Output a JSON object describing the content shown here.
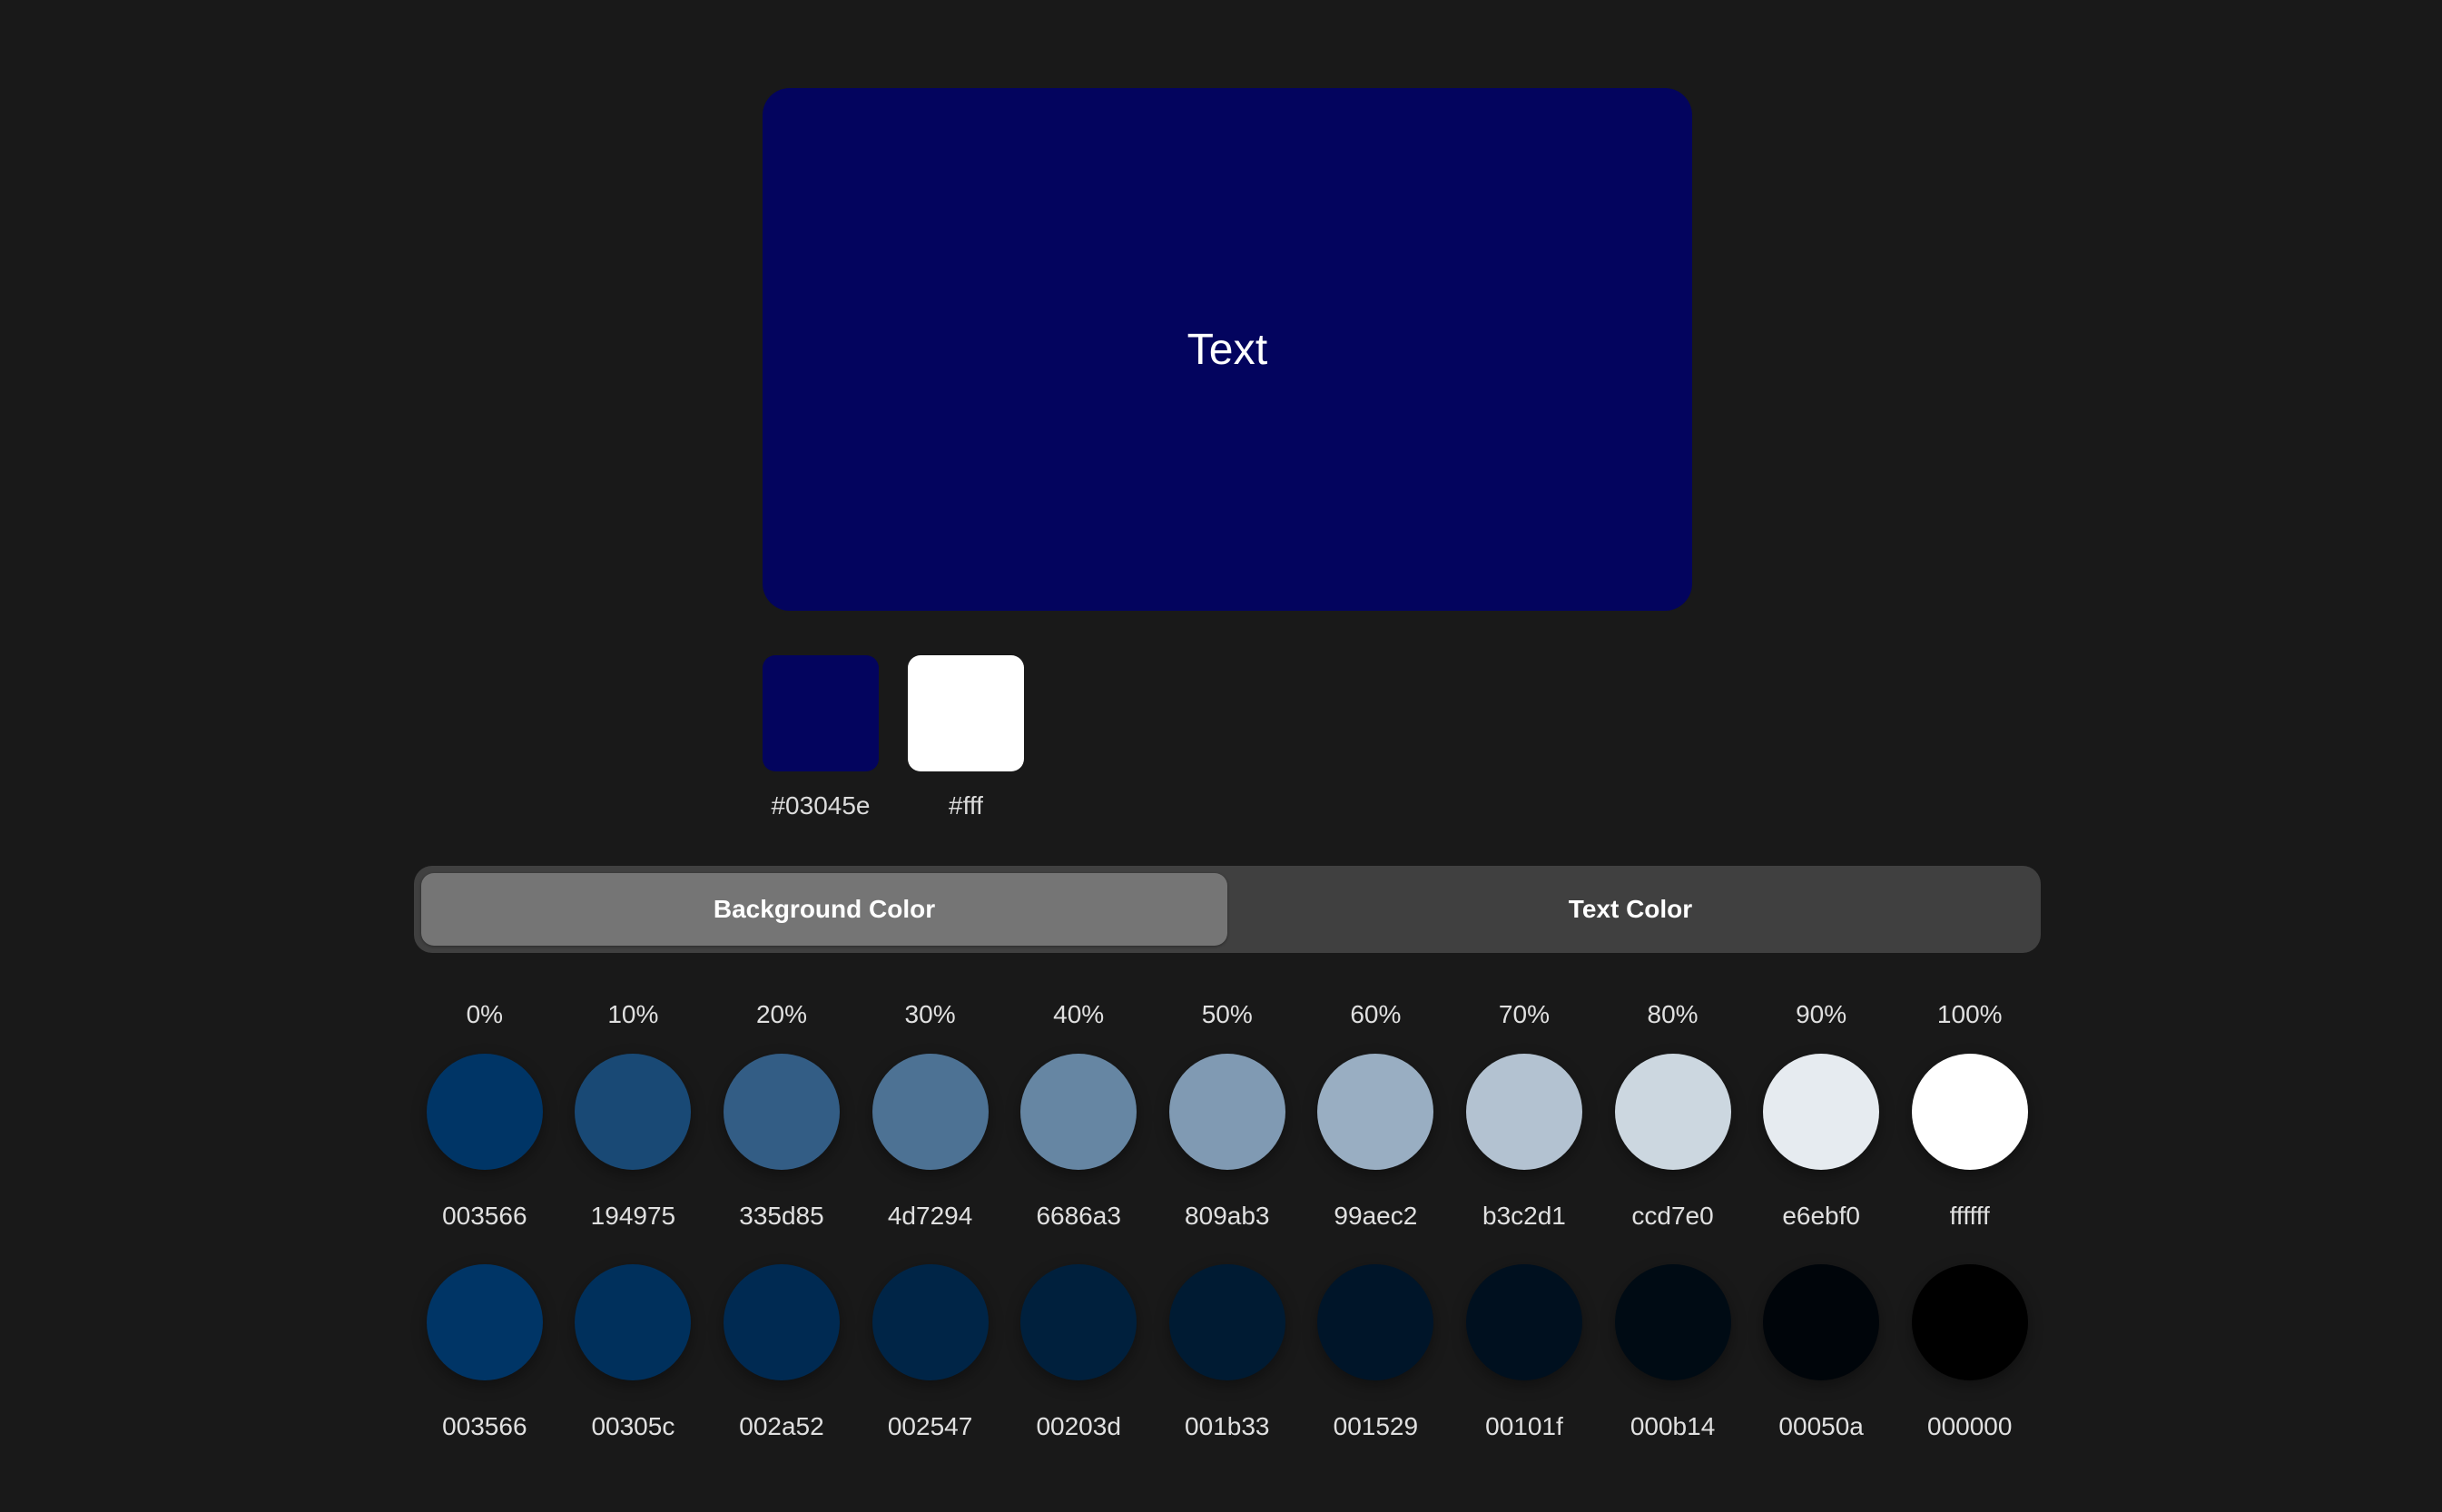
{
  "preview": {
    "text": "Text",
    "background_color": "#03045e",
    "text_color": "#ffffff"
  },
  "swatches": [
    {
      "label": "#03045e",
      "color": "#03045e"
    },
    {
      "label": "#fff",
      "color": "#ffffff"
    }
  ],
  "toggle": {
    "tabs": [
      {
        "label": "Background Color",
        "active": true
      },
      {
        "label": "Text Color",
        "active": false
      }
    ]
  },
  "tints": [
    {
      "percent": "0%",
      "hex": "003566"
    },
    {
      "percent": "10%",
      "hex": "194975"
    },
    {
      "percent": "20%",
      "hex": "335d85"
    },
    {
      "percent": "30%",
      "hex": "4d7294"
    },
    {
      "percent": "40%",
      "hex": "6686a3"
    },
    {
      "percent": "50%",
      "hex": "809ab3"
    },
    {
      "percent": "60%",
      "hex": "99aec2"
    },
    {
      "percent": "70%",
      "hex": "b3c2d1"
    },
    {
      "percent": "80%",
      "hex": "ccd7e0"
    },
    {
      "percent": "90%",
      "hex": "e6ebf0"
    },
    {
      "percent": "100%",
      "hex": "ffffff"
    }
  ],
  "shades": [
    {
      "hex": "003566"
    },
    {
      "hex": "00305c"
    },
    {
      "hex": "002a52"
    },
    {
      "hex": "002547"
    },
    {
      "hex": "00203d"
    },
    {
      "hex": "001b33"
    },
    {
      "hex": "001529"
    },
    {
      "hex": "00101f"
    },
    {
      "hex": "000b14"
    },
    {
      "hex": "00050a"
    },
    {
      "hex": "000000"
    }
  ]
}
